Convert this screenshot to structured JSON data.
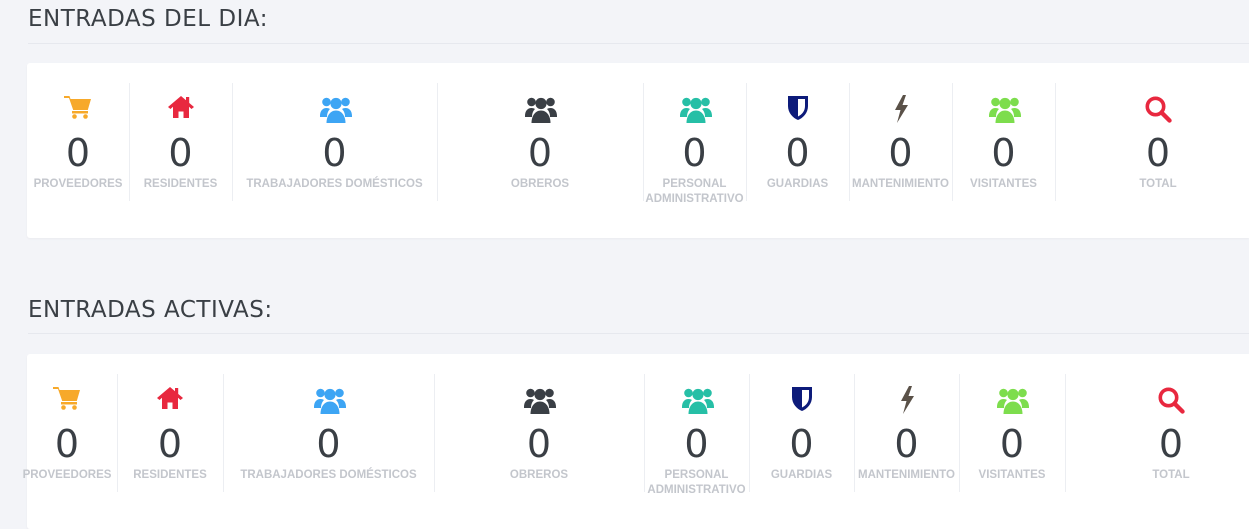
{
  "sections": [
    {
      "title": "ENTRADAS DEL DIA:",
      "stats": [
        {
          "label": "PROVEEDORES",
          "value": "0",
          "icon": "cart-icon",
          "color": "#f7a92a"
        },
        {
          "label": "RESIDENTES",
          "value": "0",
          "icon": "home-icon",
          "color": "#e8283f"
        },
        {
          "label": "TRABAJADORES DOMÉSTICOS",
          "value": "0",
          "icon": "users-icon",
          "color": "#3da5f4"
        },
        {
          "label": "OBREROS",
          "value": "0",
          "icon": "users-icon",
          "color": "#3a3f45"
        },
        {
          "label": "PERSONAL ADMINISTRATIVO",
          "value": "0",
          "icon": "users-icon",
          "color": "#26bfa6"
        },
        {
          "label": "GUARDIAS",
          "value": "0",
          "icon": "shield-icon",
          "color": "#0d1b7a"
        },
        {
          "label": "MANTENIMIENTO",
          "value": "0",
          "icon": "bolt-icon",
          "color": "#5a5148"
        },
        {
          "label": "VISITANTES",
          "value": "0",
          "icon": "users-icon",
          "color": "#7ddd4d"
        },
        {
          "label": "TOTAL",
          "value": "0",
          "icon": "search-icon",
          "color": "#e8283f"
        }
      ]
    },
    {
      "title": "ENTRADAS ACTIVAS:",
      "stats": [
        {
          "label": "PROVEEDORES",
          "value": "0",
          "icon": "cart-icon",
          "color": "#f7a92a"
        },
        {
          "label": "RESIDENTES",
          "value": "0",
          "icon": "home-icon",
          "color": "#e8283f"
        },
        {
          "label": "TRABAJADORES DOMÉSTICOS",
          "value": "0",
          "icon": "users-icon",
          "color": "#3da5f4"
        },
        {
          "label": "OBREROS",
          "value": "0",
          "icon": "users-icon",
          "color": "#3a3f45"
        },
        {
          "label": "PERSONAL ADMINISTRATIVO",
          "value": "0",
          "icon": "users-icon",
          "color": "#26bfa6"
        },
        {
          "label": "GUARDIAS",
          "value": "0",
          "icon": "shield-icon",
          "color": "#0d1b7a"
        },
        {
          "label": "MANTENIMIENTO",
          "value": "0",
          "icon": "bolt-icon",
          "color": "#5a5148"
        },
        {
          "label": "VISITANTES",
          "value": "0",
          "icon": "users-icon",
          "color": "#7ddd4d"
        },
        {
          "label": "TOTAL",
          "value": "0",
          "icon": "search-icon",
          "color": "#e8283f"
        }
      ]
    }
  ]
}
